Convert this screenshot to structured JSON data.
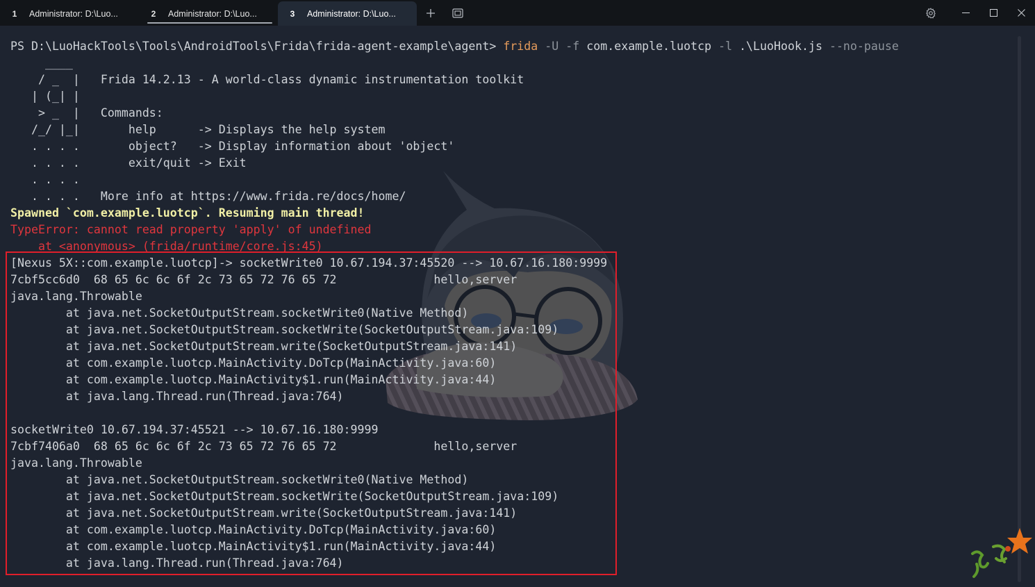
{
  "window": {
    "tabs": [
      {
        "number": "1",
        "title": "Administrator: D:\\Luo..."
      },
      {
        "number": "2",
        "title": "Administrator: D:\\Luo..."
      },
      {
        "number": "3",
        "title": "Administrator: D:\\Luo..."
      }
    ],
    "active_tab": 3
  },
  "icons": {
    "new_tab": "plus-icon",
    "tab_menu": "window-icon",
    "settings": "gear-icon",
    "minimize": "minimize-icon",
    "maximize": "maximize-icon",
    "close": "close-icon"
  },
  "colors": {
    "background": "#1e2430",
    "tab_bar": "#121519",
    "active_tab": "#222a36",
    "tab_text": "#e6e6e6",
    "tab_hover_line": "#a3a8b0",
    "text": "#cfd3d8",
    "command": "#e39a5b",
    "parameter": "#8e949c",
    "spawned": "#f2f0a6",
    "error": "#e0363d",
    "highlight_box": "#e01e2a"
  },
  "terminal": {
    "prompt": {
      "path": "PS D:\\LuoHackTools\\Tools\\AndroidTools\\Frida\\frida-agent-example\\agent>",
      "command": "frida",
      "arguments": [
        "-U",
        "-f",
        "com.example.luotcp",
        "-l",
        ".\\LuoHook.js",
        "--no-pause"
      ]
    },
    "banner": [
      "     ____",
      "    / _  |   Frida 14.2.13 - A world-class dynamic instrumentation toolkit",
      "   | (_| |",
      "    > _  |   Commands:",
      "   /_/ |_|       help      -> Displays the help system",
      "   . . . .       object?   -> Display information about 'object'",
      "   . . . .       exit/quit -> Exit",
      "   . . . .",
      "   . . . .   More info at https://www.frida.re/docs/home/"
    ],
    "spawned_message": "Spawned `com.example.luotcp`. Resuming main thread!",
    "error": [
      "TypeError: cannot read property 'apply' of undefined",
      "    at <anonymous> (frida/runtime/core.js:45)"
    ],
    "hook_output": [
      {
        "socket_line": "[Nexus 5X::com.example.luotcp]-> socketWrite0 10.67.194.37:45520 --> 10.67.16.180:9999",
        "hexdump": "7cbf5cc6d0  68 65 6c 6c 6f 2c 73 65 72 76 65 72              hello,server",
        "exception": "java.lang.Throwable",
        "stack": [
          "        at java.net.SocketOutputStream.socketWrite0(Native Method)",
          "        at java.net.SocketOutputStream.socketWrite(SocketOutputStream.java:109)",
          "        at java.net.SocketOutputStream.write(SocketOutputStream.java:141)",
          "        at com.example.luotcp.MainActivity.DoTcp(MainActivity.java:60)",
          "        at com.example.luotcp.MainActivity$1.run(MainActivity.java:44)",
          "        at java.lang.Thread.run(Thread.java:764)"
        ]
      },
      {
        "socket_line": "socketWrite0 10.67.194.37:45521 --> 10.67.16.180:9999",
        "hexdump": "7cbf7406a0  68 65 6c 6c 6f 2c 73 65 72 76 65 72              hello,server",
        "exception": "java.lang.Throwable",
        "stack": [
          "        at java.net.SocketOutputStream.socketWrite0(Native Method)",
          "        at java.net.SocketOutputStream.socketWrite(SocketOutputStream.java:109)",
          "        at java.net.SocketOutputStream.write(SocketOutputStream.java:141)",
          "        at com.example.luotcp.MainActivity.DoTcp(MainActivity.java:60)",
          "        at com.example.luotcp.MainActivity$1.run(MainActivity.java:44)",
          "        at java.lang.Thread.run(Thread.java:764)"
        ]
      }
    ]
  }
}
